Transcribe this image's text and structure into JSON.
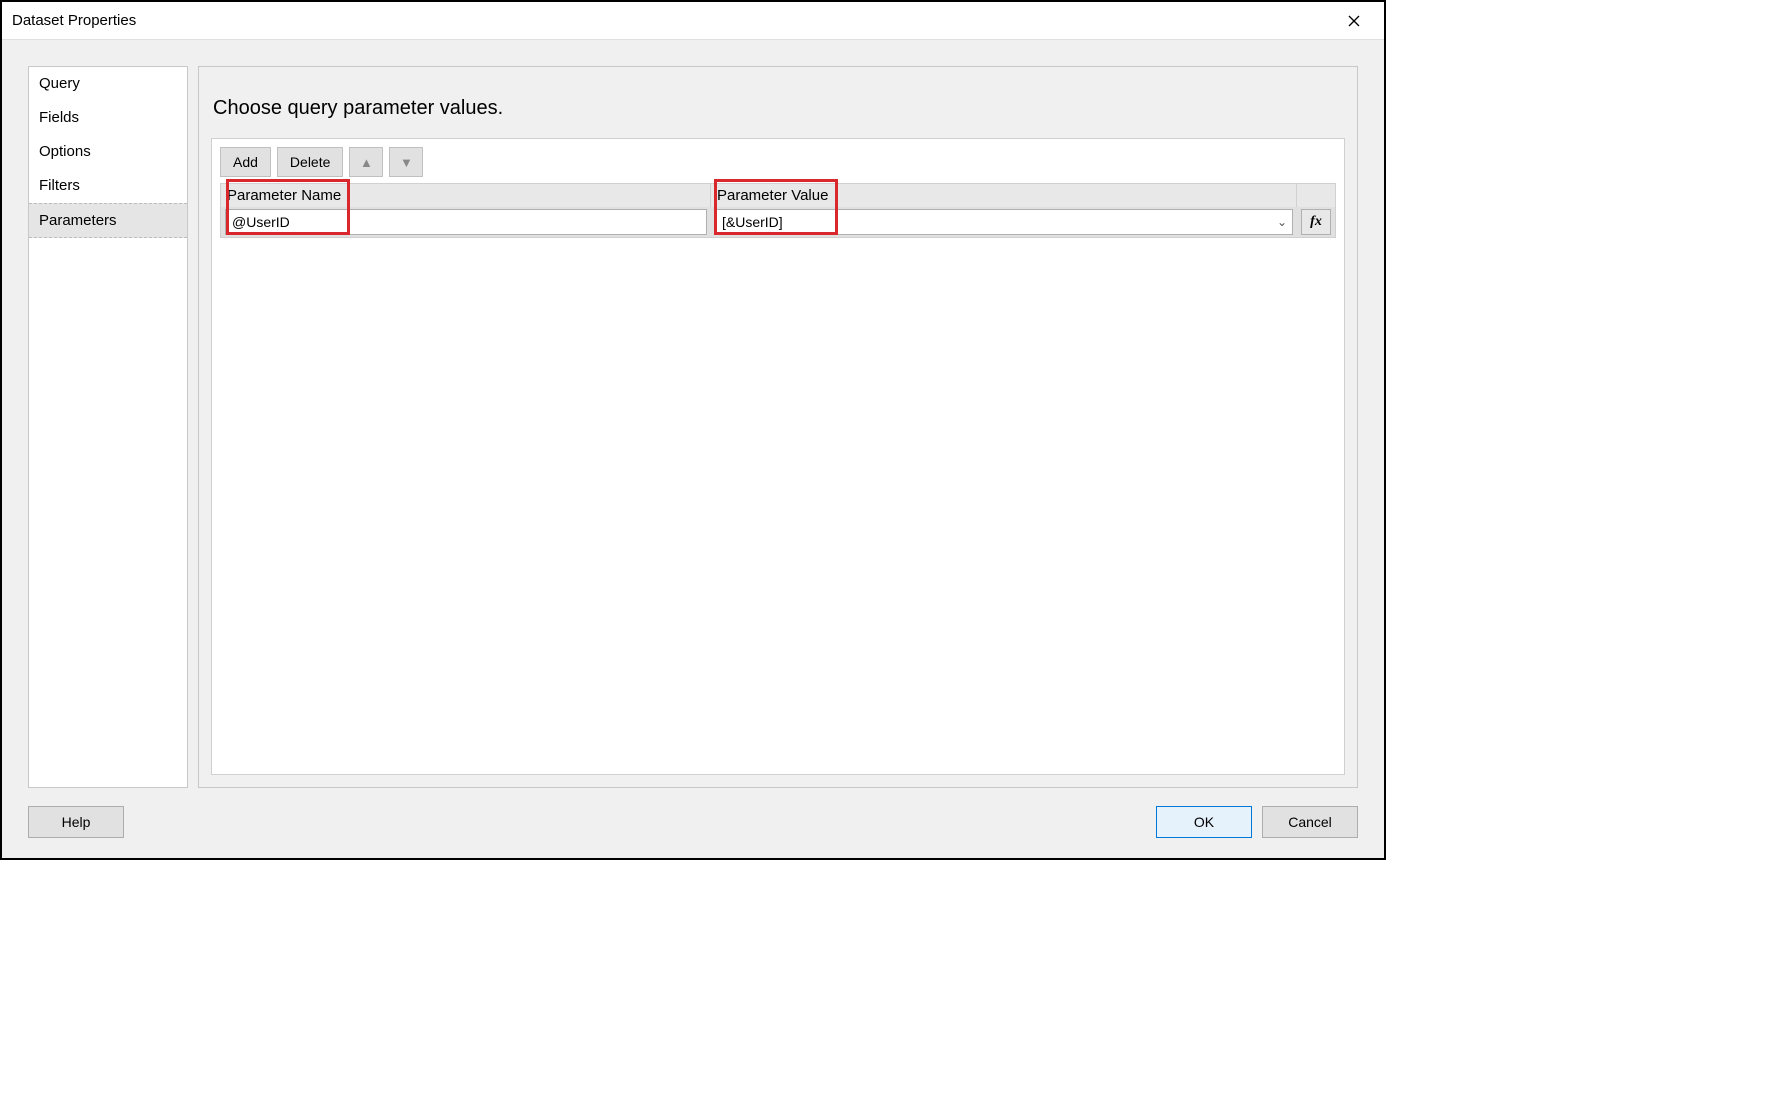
{
  "window": {
    "title": "Dataset Properties"
  },
  "sidebar": {
    "items": [
      {
        "label": "Query"
      },
      {
        "label": "Fields"
      },
      {
        "label": "Options"
      },
      {
        "label": "Filters"
      },
      {
        "label": "Parameters"
      }
    ],
    "selectedIndex": 4
  },
  "main": {
    "heading": "Choose query parameter values.",
    "toolbar": {
      "add": "Add",
      "delete": "Delete"
    },
    "grid": {
      "headers": {
        "name": "Parameter Name",
        "value": "Parameter Value"
      },
      "rows": [
        {
          "name": "@UserID",
          "value": "[&UserID]"
        }
      ]
    },
    "fxLabel": "fx"
  },
  "footer": {
    "help": "Help",
    "ok": "OK",
    "cancel": "Cancel"
  }
}
